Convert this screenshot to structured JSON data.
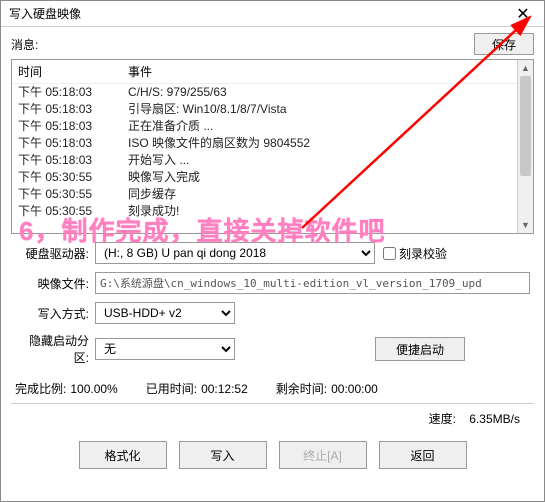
{
  "window": {
    "title": "写入硬盘映像",
    "close": "✕"
  },
  "message": {
    "label": "消息:",
    "save": "保存"
  },
  "log": {
    "headers": {
      "time": "时间",
      "event": "事件"
    },
    "rows": [
      {
        "time": "下午 05:18:03",
        "event": "C/H/S: 979/255/63"
      },
      {
        "time": "下午 05:18:03",
        "event": "引导扇区: Win10/8.1/8/7/Vista"
      },
      {
        "time": "下午 05:18:03",
        "event": "正在准备介质 ..."
      },
      {
        "time": "下午 05:18:03",
        "event": "ISO 映像文件的扇区数为 9804552"
      },
      {
        "time": "下午 05:18:03",
        "event": "开始写入 ..."
      },
      {
        "time": "下午 05:30:55",
        "event": "映像写入完成"
      },
      {
        "time": "下午 05:30:55",
        "event": "同步缓存"
      },
      {
        "time": "下午 05:30:55",
        "event": "刻录成功!"
      }
    ]
  },
  "overlay": {
    "text": "6，制作完成，直接关掉软件吧"
  },
  "form": {
    "drive": {
      "label": "硬盘驱动器:",
      "value": "(H:, 8 GB)      U pan qi dong   2018"
    },
    "verify": {
      "label": "刻录校验"
    },
    "image": {
      "label": "映像文件:",
      "value": "G:\\系统源盘\\cn_windows_10_multi-edition_vl_version_1709_upd"
    },
    "write_mode": {
      "label": "写入方式:",
      "value": "USB-HDD+ v2"
    },
    "hide_boot": {
      "label": "隐藏启动分区:",
      "value": "无"
    },
    "quick_boot": "便捷启动"
  },
  "progress": {
    "percent_label": "完成比例:",
    "percent_value": "100.00%",
    "elapsed_label": "已用时间:",
    "elapsed_value": "00:12:52",
    "remain_label": "剩余时间:",
    "remain_value": "00:00:00",
    "speed_label": "速度:",
    "speed_value": "6.35MB/s"
  },
  "buttons": {
    "format": "格式化",
    "write": "写入",
    "abort": "终止[A]",
    "back": "返回"
  },
  "colors": {
    "annotation": "#ff0000",
    "overlay_text": "#ff7fbf"
  }
}
